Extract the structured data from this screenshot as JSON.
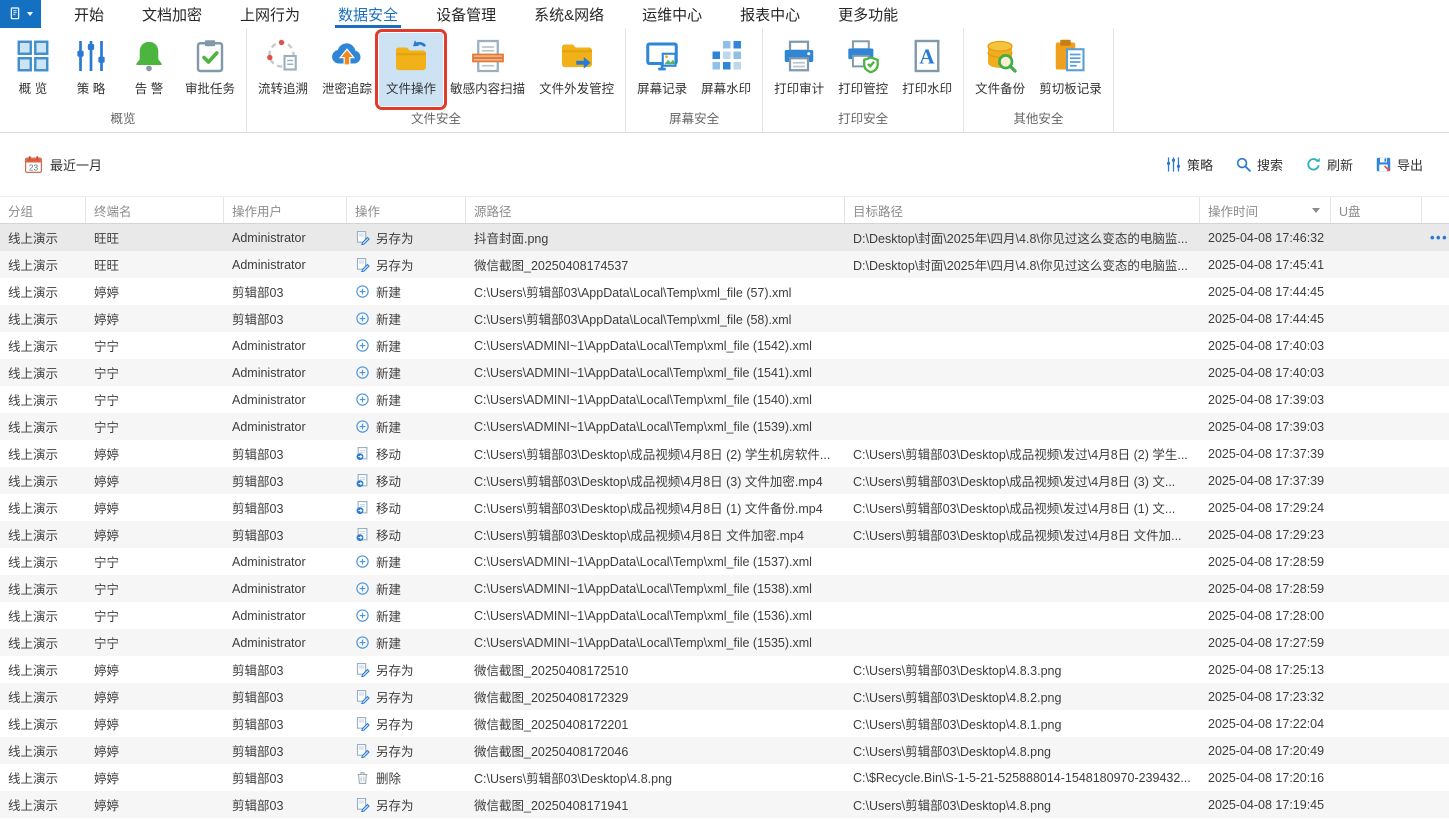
{
  "colors": {
    "accent": "#1b6ec2",
    "highlight_box": "#e13b2c",
    "selected_row": "#e9e9e9"
  },
  "menu": {
    "tabs": [
      {
        "id": "start",
        "label": "开始",
        "active": false
      },
      {
        "id": "doc-encrypt",
        "label": "文档加密",
        "active": false
      },
      {
        "id": "internet-behavior",
        "label": "上网行为",
        "active": false
      },
      {
        "id": "data-security",
        "label": "数据安全",
        "active": true
      },
      {
        "id": "device-mgmt",
        "label": "设备管理",
        "active": false
      },
      {
        "id": "system-network",
        "label": "系统&网络",
        "active": false
      },
      {
        "id": "ops-center",
        "label": "运维中心",
        "active": false
      },
      {
        "id": "report-center",
        "label": "报表中心",
        "active": false
      },
      {
        "id": "more-features",
        "label": "更多功能",
        "active": false
      }
    ]
  },
  "ribbon": {
    "groups": [
      {
        "label": "概览",
        "buttons": [
          {
            "icon": "grid",
            "label": "概 览"
          },
          {
            "icon": "sliders",
            "label": "策 略"
          },
          {
            "icon": "bell",
            "label": "告 警"
          },
          {
            "icon": "clipboard-check",
            "label": "审批任务"
          }
        ]
      },
      {
        "label": "文件安全",
        "buttons": [
          {
            "icon": "trace-cycle",
            "label": "流转追溯"
          },
          {
            "icon": "leak-cloud",
            "label": "泄密追踪"
          },
          {
            "icon": "folder-ops",
            "label": "文件操作",
            "highlighted": true
          },
          {
            "icon": "doc-scan",
            "label": "敏感内容扫描"
          },
          {
            "icon": "folder-send",
            "label": "文件外发管控"
          }
        ]
      },
      {
        "label": "屏幕安全",
        "buttons": [
          {
            "icon": "screen-record",
            "label": "屏幕记录"
          },
          {
            "icon": "screen-watermark",
            "label": "屏幕水印"
          }
        ]
      },
      {
        "label": "打印安全",
        "buttons": [
          {
            "icon": "print-audit",
            "label": "打印审计"
          },
          {
            "icon": "print-control",
            "label": "打印管控"
          },
          {
            "icon": "print-watermark",
            "label": "打印水印"
          }
        ]
      },
      {
        "label": "其他安全",
        "buttons": [
          {
            "icon": "file-backup",
            "label": "文件备份"
          },
          {
            "icon": "clipboard-record",
            "label": "剪切板记录"
          }
        ]
      }
    ]
  },
  "filter_bar": {
    "date": {
      "day": "23",
      "label": "最近一月"
    },
    "actions": [
      {
        "id": "policy",
        "icon": "sliders",
        "label": "策略"
      },
      {
        "id": "search",
        "icon": "search",
        "label": "搜索"
      },
      {
        "id": "refresh",
        "icon": "refresh",
        "label": "刷新"
      },
      {
        "id": "export",
        "icon": "export",
        "label": "导出"
      }
    ]
  },
  "table": {
    "columns": [
      {
        "id": "group",
        "label": "分组"
      },
      {
        "id": "terminal",
        "label": "终端名"
      },
      {
        "id": "user",
        "label": "操作用户"
      },
      {
        "id": "operation",
        "label": "操作"
      },
      {
        "id": "source-path",
        "label": "源路径"
      },
      {
        "id": "target-path",
        "label": "目标路径"
      },
      {
        "id": "time",
        "label": "操作时间",
        "sortable": true
      },
      {
        "id": "usb",
        "label": "U盘"
      },
      {
        "id": "actions",
        "label": ""
      }
    ],
    "rows": [
      {
        "group": "线上演示",
        "terminal": "旺旺",
        "user": "Administrator",
        "op_icon": "saveas",
        "op_label": "另存为",
        "source": "抖音封面.png",
        "target": "D:\\Desktop\\封面\\2025年\\四月\\4.8\\你见过这么变态的电脑监...",
        "time": "2025-04-08 17:46:32",
        "usb": "",
        "selected": true
      },
      {
        "group": "线上演示",
        "terminal": "旺旺",
        "user": "Administrator",
        "op_icon": "saveas",
        "op_label": "另存为",
        "source": "微信截图_20250408174537",
        "target": "D:\\Desktop\\封面\\2025年\\四月\\4.8\\你见过这么变态的电脑监...",
        "time": "2025-04-08 17:45:41",
        "usb": ""
      },
      {
        "group": "线上演示",
        "terminal": "婷婷",
        "user": "剪辑部03",
        "op_icon": "new",
        "op_label": "新建",
        "source": "C:\\Users\\剪辑部03\\AppData\\Local\\Temp\\xml_file (57).xml",
        "target": "",
        "time": "2025-04-08 17:44:45",
        "usb": ""
      },
      {
        "group": "线上演示",
        "terminal": "婷婷",
        "user": "剪辑部03",
        "op_icon": "new",
        "op_label": "新建",
        "source": "C:\\Users\\剪辑部03\\AppData\\Local\\Temp\\xml_file (58).xml",
        "target": "",
        "time": "2025-04-08 17:44:45",
        "usb": ""
      },
      {
        "group": "线上演示",
        "terminal": "宁宁",
        "user": "Administrator",
        "op_icon": "new",
        "op_label": "新建",
        "source": "C:\\Users\\ADMINI~1\\AppData\\Local\\Temp\\xml_file (1542).xml",
        "target": "",
        "time": "2025-04-08 17:40:03",
        "usb": ""
      },
      {
        "group": "线上演示",
        "terminal": "宁宁",
        "user": "Administrator",
        "op_icon": "new",
        "op_label": "新建",
        "source": "C:\\Users\\ADMINI~1\\AppData\\Local\\Temp\\xml_file (1541).xml",
        "target": "",
        "time": "2025-04-08 17:40:03",
        "usb": ""
      },
      {
        "group": "线上演示",
        "terminal": "宁宁",
        "user": "Administrator",
        "op_icon": "new",
        "op_label": "新建",
        "source": "C:\\Users\\ADMINI~1\\AppData\\Local\\Temp\\xml_file (1540).xml",
        "target": "",
        "time": "2025-04-08 17:39:03",
        "usb": ""
      },
      {
        "group": "线上演示",
        "terminal": "宁宁",
        "user": "Administrator",
        "op_icon": "new",
        "op_label": "新建",
        "source": "C:\\Users\\ADMINI~1\\AppData\\Local\\Temp\\xml_file (1539).xml",
        "target": "",
        "time": "2025-04-08 17:39:03",
        "usb": ""
      },
      {
        "group": "线上演示",
        "terminal": "婷婷",
        "user": "剪辑部03",
        "op_icon": "move",
        "op_label": "移动",
        "source": "C:\\Users\\剪辑部03\\Desktop\\成品视频\\4月8日 (2)  学生机房软件...",
        "target": "C:\\Users\\剪辑部03\\Desktop\\成品视频\\发过\\4月8日 (2)  学生...",
        "time": "2025-04-08 17:37:39",
        "usb": ""
      },
      {
        "group": "线上演示",
        "terminal": "婷婷",
        "user": "剪辑部03",
        "op_icon": "move",
        "op_label": "移动",
        "source": "C:\\Users\\剪辑部03\\Desktop\\成品视频\\4月8日 (3)  文件加密.mp4",
        "target": "C:\\Users\\剪辑部03\\Desktop\\成品视频\\发过\\4月8日 (3)  文...",
        "time": "2025-04-08 17:37:39",
        "usb": ""
      },
      {
        "group": "线上演示",
        "terminal": "婷婷",
        "user": "剪辑部03",
        "op_icon": "move",
        "op_label": "移动",
        "source": "C:\\Users\\剪辑部03\\Desktop\\成品视频\\4月8日 (1)  文件备份.mp4",
        "target": "C:\\Users\\剪辑部03\\Desktop\\成品视频\\发过\\4月8日 (1)  文...",
        "time": "2025-04-08 17:29:24",
        "usb": ""
      },
      {
        "group": "线上演示",
        "terminal": "婷婷",
        "user": "剪辑部03",
        "op_icon": "move",
        "op_label": "移动",
        "source": "C:\\Users\\剪辑部03\\Desktop\\成品视频\\4月8日  文件加密.mp4",
        "target": "C:\\Users\\剪辑部03\\Desktop\\成品视频\\发过\\4月8日  文件加...",
        "time": "2025-04-08 17:29:23",
        "usb": ""
      },
      {
        "group": "线上演示",
        "terminal": "宁宁",
        "user": "Administrator",
        "op_icon": "new",
        "op_label": "新建",
        "source": "C:\\Users\\ADMINI~1\\AppData\\Local\\Temp\\xml_file (1537).xml",
        "target": "",
        "time": "2025-04-08 17:28:59",
        "usb": ""
      },
      {
        "group": "线上演示",
        "terminal": "宁宁",
        "user": "Administrator",
        "op_icon": "new",
        "op_label": "新建",
        "source": "C:\\Users\\ADMINI~1\\AppData\\Local\\Temp\\xml_file (1538).xml",
        "target": "",
        "time": "2025-04-08 17:28:59",
        "usb": ""
      },
      {
        "group": "线上演示",
        "terminal": "宁宁",
        "user": "Administrator",
        "op_icon": "new",
        "op_label": "新建",
        "source": "C:\\Users\\ADMINI~1\\AppData\\Local\\Temp\\xml_file (1536).xml",
        "target": "",
        "time": "2025-04-08 17:28:00",
        "usb": ""
      },
      {
        "group": "线上演示",
        "terminal": "宁宁",
        "user": "Administrator",
        "op_icon": "new",
        "op_label": "新建",
        "source": "C:\\Users\\ADMINI~1\\AppData\\Local\\Temp\\xml_file (1535).xml",
        "target": "",
        "time": "2025-04-08 17:27:59",
        "usb": ""
      },
      {
        "group": "线上演示",
        "terminal": "婷婷",
        "user": "剪辑部03",
        "op_icon": "saveas",
        "op_label": "另存为",
        "source": "微信截图_20250408172510",
        "target": "C:\\Users\\剪辑部03\\Desktop\\4.8.3.png",
        "time": "2025-04-08 17:25:13",
        "usb": ""
      },
      {
        "group": "线上演示",
        "terminal": "婷婷",
        "user": "剪辑部03",
        "op_icon": "saveas",
        "op_label": "另存为",
        "source": "微信截图_20250408172329",
        "target": "C:\\Users\\剪辑部03\\Desktop\\4.8.2.png",
        "time": "2025-04-08 17:23:32",
        "usb": ""
      },
      {
        "group": "线上演示",
        "terminal": "婷婷",
        "user": "剪辑部03",
        "op_icon": "saveas",
        "op_label": "另存为",
        "source": "微信截图_20250408172201",
        "target": "C:\\Users\\剪辑部03\\Desktop\\4.8.1.png",
        "time": "2025-04-08 17:22:04",
        "usb": ""
      },
      {
        "group": "线上演示",
        "terminal": "婷婷",
        "user": "剪辑部03",
        "op_icon": "saveas",
        "op_label": "另存为",
        "source": "微信截图_20250408172046",
        "target": "C:\\Users\\剪辑部03\\Desktop\\4.8.png",
        "time": "2025-04-08 17:20:49",
        "usb": ""
      },
      {
        "group": "线上演示",
        "terminal": "婷婷",
        "user": "剪辑部03",
        "op_icon": "delete",
        "op_label": "删除",
        "source": "C:\\Users\\剪辑部03\\Desktop\\4.8.png",
        "target": "C:\\$Recycle.Bin\\S-1-5-21-525888014-1548180970-239432...",
        "time": "2025-04-08 17:20:16",
        "usb": ""
      },
      {
        "group": "线上演示",
        "terminal": "婷婷",
        "user": "剪辑部03",
        "op_icon": "saveas",
        "op_label": "另存为",
        "source": "微信截图_20250408171941",
        "target": "C:\\Users\\剪辑部03\\Desktop\\4.8.png",
        "time": "2025-04-08 17:19:45",
        "usb": ""
      }
    ],
    "row_actions_label": "•••"
  }
}
